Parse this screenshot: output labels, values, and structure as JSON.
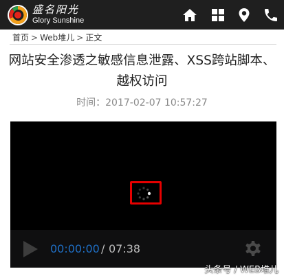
{
  "header": {
    "brand_cn": "盛名阳光",
    "brand_en": "Glory Sunshine",
    "icons": [
      "home-icon",
      "grid-icon",
      "location-pin-icon",
      "phone-icon"
    ],
    "background": "#1f1f1f"
  },
  "breadcrumb": {
    "items": [
      "首页",
      "Web堆儿",
      "正文"
    ],
    "separator": ">"
  },
  "article": {
    "title_line1": "网站安全渗透之敏感信息泄露、XSS跨站脚本、",
    "title_line2": "越权访问",
    "time_label": "时间：",
    "time_value": "2017-02-07 10:57:27"
  },
  "video": {
    "current_time": "00:00:00",
    "separator": "/",
    "duration": "07:38",
    "state": "loading",
    "highlight_color": "#e60000",
    "time_color": "#1f6fc5"
  },
  "watermark": "头条号 / WEB堆儿"
}
